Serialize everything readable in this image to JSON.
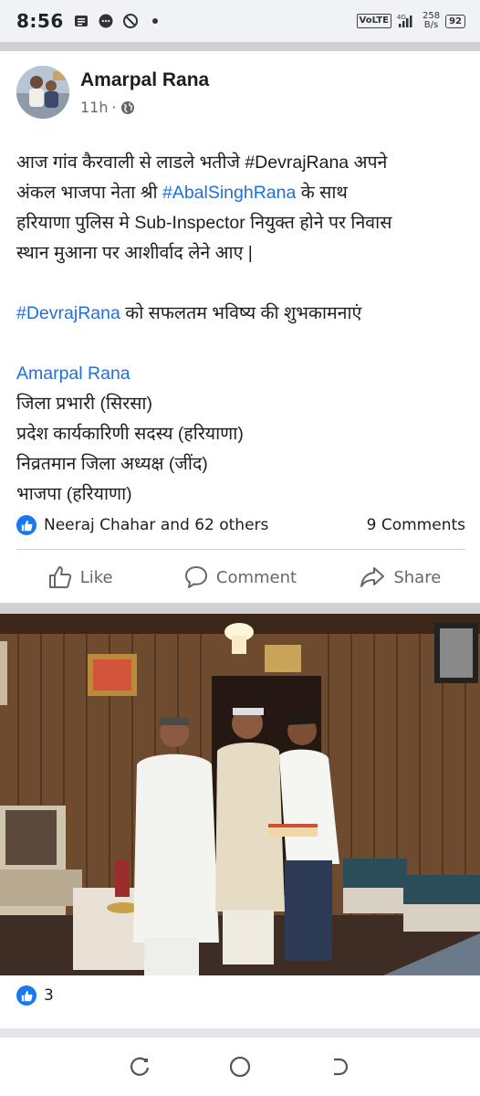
{
  "status_bar": {
    "time": "8:56",
    "network": "VoLTE",
    "network_gen": "4G",
    "speed_value": "258",
    "speed_unit": "B/s",
    "battery": "92"
  },
  "post": {
    "author": "Amarpal Rana",
    "time_ago": "11h",
    "body": {
      "line1_a": "आज गांव कैरवाली से लाडले भतीजे #DevrajRana अपने",
      "line2_a": "अंकल भाजपा नेता श्री ",
      "line2_link": "#AbalSinghRana",
      "line2_b": " के साथ",
      "line3": "हरियाणा पुलिस मे Sub-Inspector नियुक्त होने पर निवास",
      "line4": "स्थान मुआना पर आशीर्वाद लेने आए |",
      "wish_link": "#DevrajRana",
      "wish_text": " को सफलतम भविष्य की शुभकामनाएं",
      "sig_name": "Amarpal Rana",
      "sig_line1": "जिला प्रभारी (सिरसा)",
      "sig_line2": "प्रदेश कार्यकारिणी सदस्य (हरियाणा)",
      "sig_line3": "निव्रतमान जिला अध्यक्ष (जींद)",
      "sig_line4": "भाजपा (हरियाणा)"
    },
    "reactions_text": "Neeraj Chahar and 62 others",
    "comments_text": "9 Comments",
    "actions": {
      "like": "Like",
      "comment": "Comment",
      "share": "Share"
    }
  },
  "photo": {
    "like_count": "3"
  },
  "colors": {
    "link": "#216fdb",
    "like_blue": "#1877f2",
    "divider": "#ced0d4",
    "status_bg": "#f0f2f5"
  }
}
